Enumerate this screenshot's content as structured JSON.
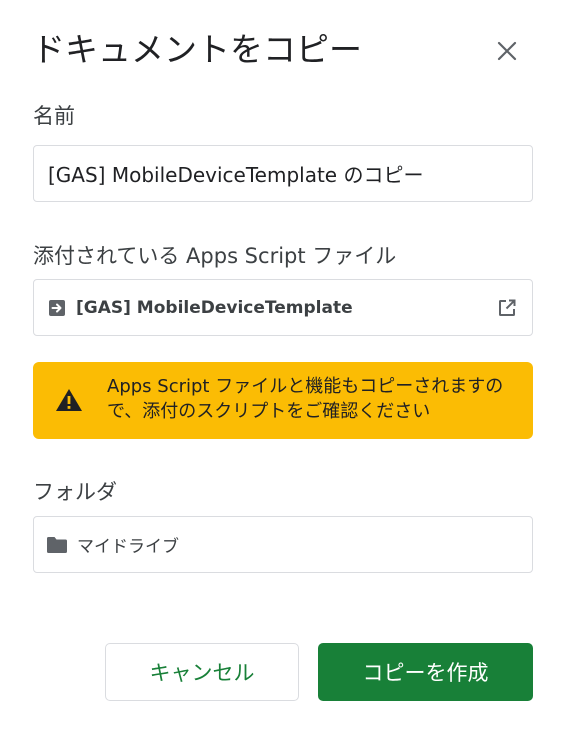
{
  "dialog": {
    "title": "ドキュメントをコピー",
    "close_icon": "close-icon"
  },
  "name_section": {
    "label": "名前",
    "value": "[GAS] MobileDeviceTemplate のコピー"
  },
  "script_section": {
    "label": "添付されている Apps Script ファイル",
    "file_icon": "apps-script-arrow-icon",
    "file_name": "[GAS] MobileDeviceTemplate",
    "open_icon": "open-in-new-icon"
  },
  "warning": {
    "icon": "warning-triangle-icon",
    "text": "Apps Script ファイルと機能もコピーされますので、添付のスクリプトをご確認ください",
    "background": "#fbbc04"
  },
  "folder_section": {
    "label": "フォルダ",
    "folder_icon": "folder-icon",
    "folder_name": "マイドライブ"
  },
  "actions": {
    "cancel_label": "キャンセル",
    "confirm_label": "コピーを作成"
  },
  "colors": {
    "primary": "#188038",
    "warning": "#fbbc04",
    "border": "#dadce0"
  }
}
